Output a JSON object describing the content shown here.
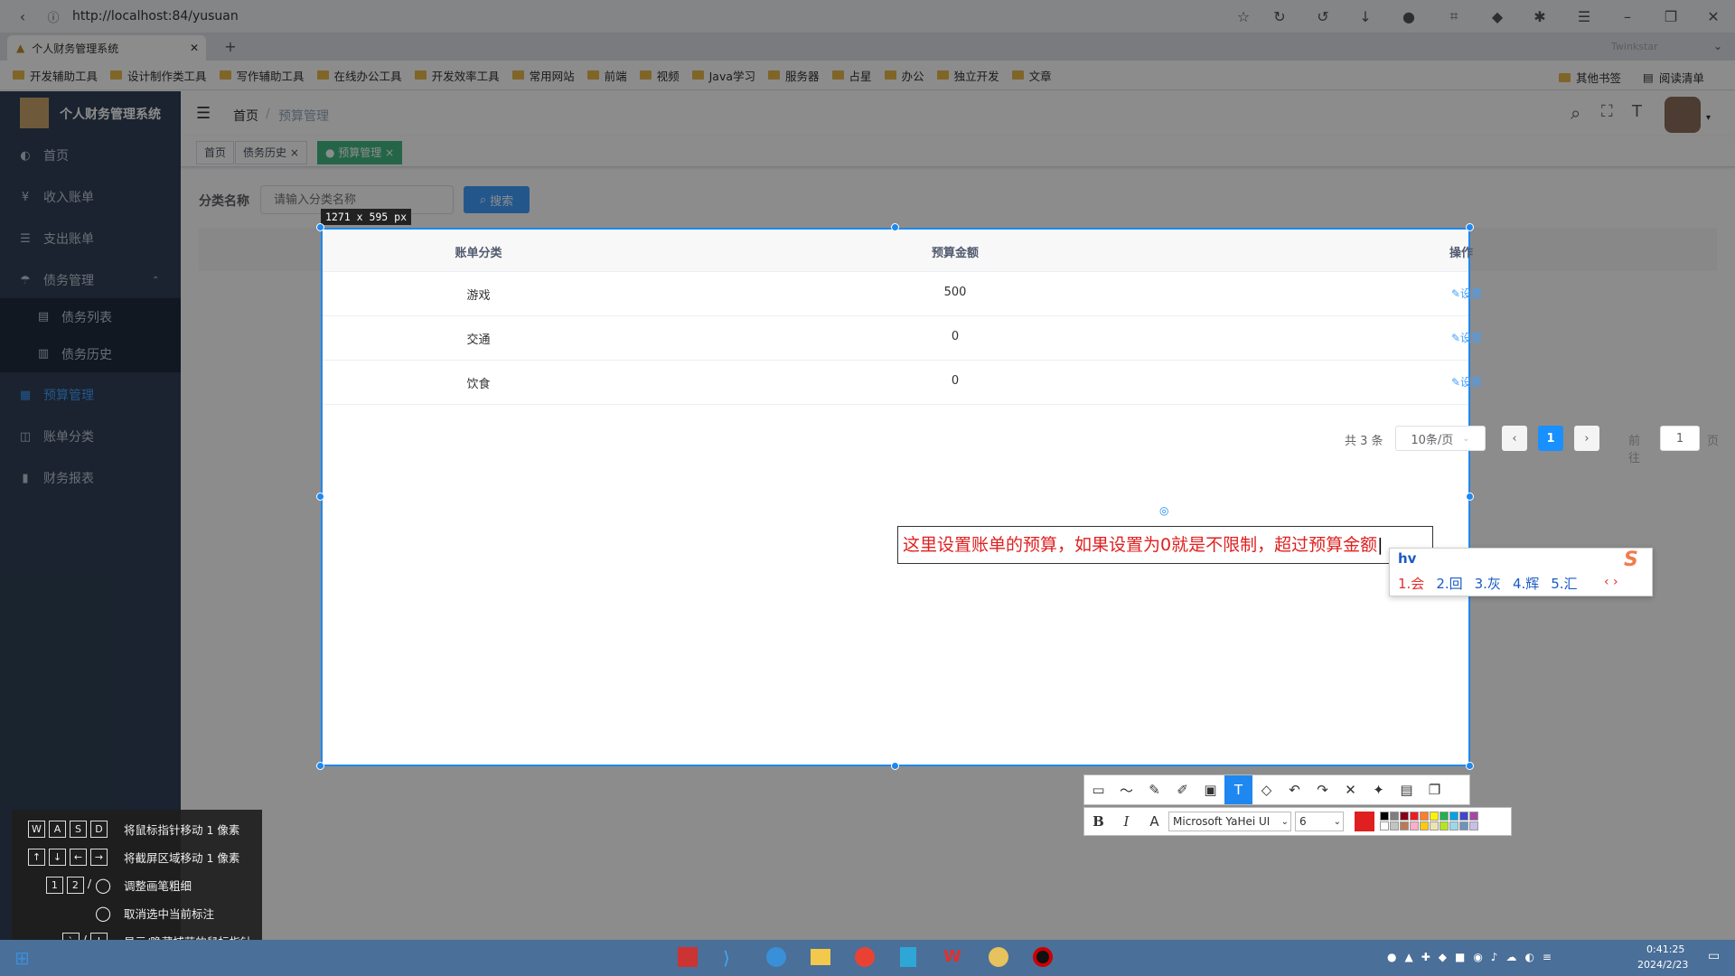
{
  "browser": {
    "url": "http://localhost:84/yusuan",
    "tab_title": "个人财务管理系统",
    "profile_label": "Twinkstar",
    "bookmarks": [
      "开发辅助工具",
      "设计制作类工具",
      "写作辅助工具",
      "在线办公工具",
      "开发效率工具",
      "常用网站",
      "前端",
      "视频",
      "Java学习",
      "服务器",
      "占星",
      "办公",
      "独立开发",
      "文章"
    ],
    "other_bookmarks": "其他书签",
    "reading_list": "阅读清单"
  },
  "sidebar": {
    "app_title": "个人财务管理系统",
    "items": [
      {
        "label": "首页",
        "icon": "dashboard-icon"
      },
      {
        "label": "收入账单",
        "icon": "yen-icon"
      },
      {
        "label": "支出账单",
        "icon": "list-icon"
      },
      {
        "label": "债务管理",
        "icon": "debt-icon"
      },
      {
        "label": "债务列表",
        "icon": "document-icon"
      },
      {
        "label": "债务历史",
        "icon": "history-icon"
      },
      {
        "label": "预算管理",
        "icon": "budget-icon"
      },
      {
        "label": "账单分类",
        "icon": "category-icon"
      },
      {
        "label": "财务报表",
        "icon": "chart-icon"
      }
    ]
  },
  "navbar": {
    "breadcrumb_home": "首页",
    "breadcrumb_sep": "/",
    "breadcrumb_current": "预算管理"
  },
  "tags": [
    {
      "label": "首页"
    },
    {
      "label": "债务历史",
      "close": "×"
    },
    {
      "label": "预算管理",
      "close": "×"
    }
  ],
  "search": {
    "label": "分类名称",
    "placeholder": "请输入分类名称",
    "button": "搜索"
  },
  "capture": {
    "size_label": "1271 x 595  px"
  },
  "table": {
    "headers": [
      "账单分类",
      "预算金额",
      "操作"
    ],
    "rows": [
      {
        "category": "游戏",
        "amount": "500",
        "action": "设置"
      },
      {
        "category": "交通",
        "amount": "0",
        "action": "设置"
      },
      {
        "category": "饮食",
        "amount": "0",
        "action": "设置"
      }
    ]
  },
  "pagination": {
    "total": "共 3 条",
    "page_size": "10条/页",
    "current": "1",
    "goto_label": "前往",
    "goto_value": "1",
    "page_unit": "页",
    "prev": "‹",
    "next": "›"
  },
  "annotation": {
    "text": "这里设置账单的预算，如果设置为0就是不限制，超过预算金额"
  },
  "ime": {
    "input": "hv",
    "candidates": [
      "1.会",
      "2.回",
      "3.灰",
      "4.辉",
      "5.汇"
    ],
    "nav": "‹ ›"
  },
  "annotation_toolbar": {
    "font": "Microsoft YaHei UI",
    "size": "6",
    "bold": "B",
    "italic": "I"
  },
  "help": [
    {
      "keys": [
        "W",
        "A",
        "S",
        "D"
      ],
      "text": "将鼠标指针移动 1 像素"
    },
    {
      "keys": [
        "↑",
        "↓",
        "←",
        "→"
      ],
      "text": "将截屏区域移动 1 像素"
    },
    {
      "keys": [
        "1",
        "2",
        "/"
      ],
      "text": "调整画笔粗细"
    },
    {
      "keys": [],
      "text": "取消选中当前标注"
    },
    {
      "keys": [
        "`",
        "/",
        "!"
      ],
      "text": "显示/隐藏捕获的鼠标指针"
    }
  ],
  "clock": {
    "time": "0:41:25",
    "date": "2024/2/23"
  },
  "colors": {
    "accent": "#1e88f0",
    "sidebar": "#304156",
    "annotation": "#e02020"
  }
}
